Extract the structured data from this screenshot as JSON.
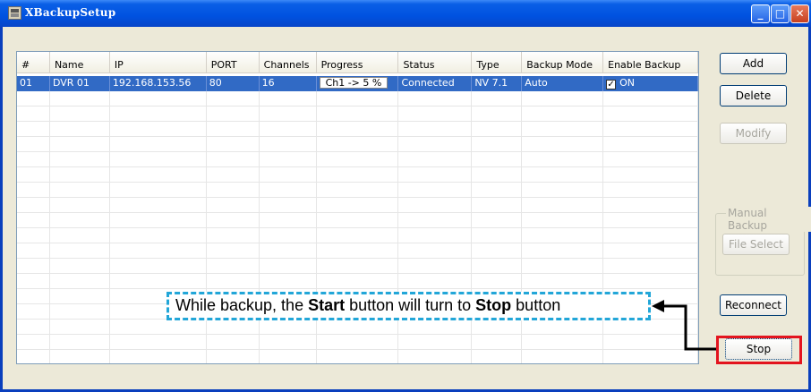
{
  "window": {
    "title": "XBackupSetup"
  },
  "table": {
    "columns": [
      "#",
      "Name",
      "IP",
      "PORT",
      "Channels",
      "Progress",
      "Status",
      "Type",
      "Backup Mode",
      "Enable Backup"
    ],
    "rows": [
      {
        "num": "01",
        "name": "DVR 01",
        "ip": "192.168.153.56",
        "port": "80",
        "channels": "16",
        "progress": "Ch1 -> 5 %",
        "status": "Connected",
        "type": "NV 7.1",
        "backup_mode": "Auto",
        "enable_backup": "ON",
        "enable_checked": true,
        "selected": true
      }
    ]
  },
  "buttons": {
    "add": "Add",
    "delete": "Delete",
    "modify": "Modify",
    "file_select": "File Select",
    "reconnect": "Reconnect",
    "stop": "Stop"
  },
  "manual_backup_group": "Manual Backup",
  "annotation": {
    "part1": "While backup, the ",
    "start": "Start",
    "part2": " button will turn to ",
    "stop": "Stop",
    "part3": " button"
  },
  "colors": {
    "titlebar": "#0052e0",
    "selection": "#316ac5",
    "callout_border": "#22a6d8",
    "highlight_border": "#e3141e"
  }
}
